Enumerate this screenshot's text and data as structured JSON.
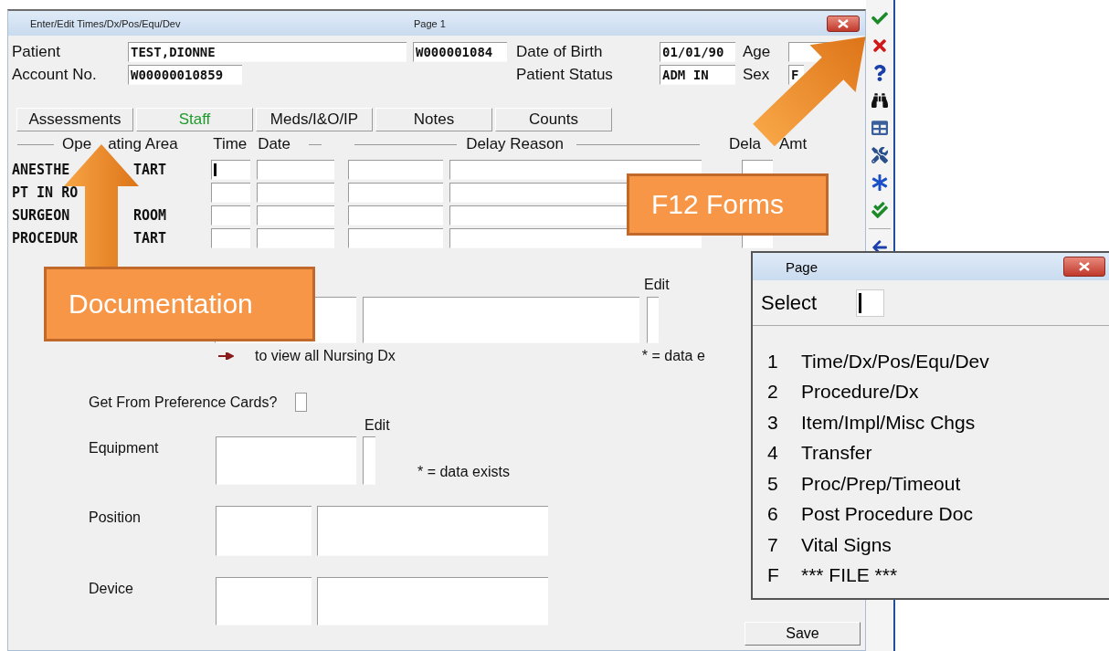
{
  "window": {
    "title": "Enter/Edit Times/Dx/Pos/Equ/Dev",
    "page": "Page 1"
  },
  "patient": {
    "patient_label": "Patient",
    "patient_name": "TEST,DIONNE",
    "patient_id": "W000001084",
    "dob_label": "Date of Birth",
    "dob": "01/01/90",
    "age_label": "Age",
    "account_label": "Account No.",
    "account": "W00000010859",
    "status_label": "Patient Status",
    "status": "ADM IN",
    "sex_label": "Sex",
    "sex": "F"
  },
  "tabs": [
    {
      "label": "Assessments",
      "selected": false
    },
    {
      "label": "Staff",
      "selected": true
    },
    {
      "label": "Meds/I&O/IP",
      "selected": false
    },
    {
      "label": "Notes",
      "selected": false
    },
    {
      "label": "Counts",
      "selected": false
    }
  ],
  "times": {
    "headers": {
      "area_left": "Ope",
      "area_right": "ating Area",
      "time": "Time",
      "date": "Date",
      "delay_reason": "Delay Reason",
      "delay_amt_left": "Dela",
      "delay_amt_right": "Amt"
    },
    "rows": [
      {
        "label_left": "ANESTHE",
        "label_right": "TART",
        "focused": true
      },
      {
        "label_left": "PT IN RO",
        "focused": false
      },
      {
        "label_left": "SURGEON",
        "label_right": "ROOM",
        "focused": false
      },
      {
        "label_left": "PROCEDUR",
        "label_right": "TART",
        "focused": false
      }
    ]
  },
  "diagnosis": {
    "edit_label": "Edit",
    "hint": "to view all Nursing Dx",
    "legend": "* = data e"
  },
  "preference": {
    "label": "Get From Preference Cards?",
    "checked": false
  },
  "equipment": {
    "label": "Equipment",
    "edit_label": "Edit",
    "legend": "* = data exists"
  },
  "position": {
    "label": "Position"
  },
  "device": {
    "label": "Device"
  },
  "save_button": "Save",
  "callouts": [
    {
      "text": "Documentation"
    },
    {
      "text": "F12 Forms"
    }
  ],
  "page_dialog": {
    "title": "Page",
    "select_label": "Select",
    "select_focused": true,
    "items": [
      {
        "key": "1",
        "label": "Time/Dx/Pos/Equ/Dev"
      },
      {
        "key": "2",
        "label": "Procedure/Dx"
      },
      {
        "key": "3",
        "label": "Item/Impl/Misc Chgs"
      },
      {
        "key": "4",
        "label": "Transfer"
      },
      {
        "key": "5",
        "label": "Proc/Prep/Timeout"
      },
      {
        "key": "6",
        "label": "Post Procedure Doc"
      },
      {
        "key": "7",
        "label": "Vital Signs"
      },
      {
        "key": "F",
        "label": "*** FILE ***"
      }
    ]
  }
}
